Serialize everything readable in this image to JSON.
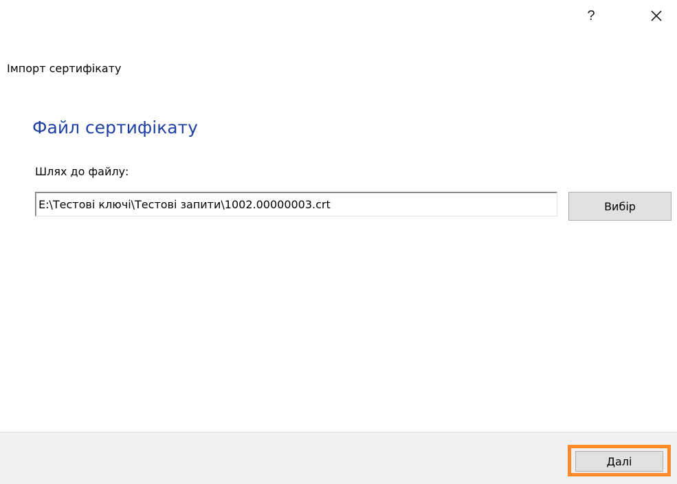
{
  "window": {
    "help_label": "?",
    "close_icon": "close-icon"
  },
  "wizard": {
    "title": "Імпорт сертифікату"
  },
  "main": {
    "heading": "Файл сертифікату",
    "path_label": "Шлях до файлу:",
    "path_value": "E:\\Тестові ключі\\Тестові запити\\1002.00000003.crt",
    "browse_label": "Вибір"
  },
  "footer": {
    "next_label": "Далі"
  },
  "colors": {
    "heading": "#1f3fa3",
    "highlight": "#ff8a2a",
    "footer_bg": "#f0f0f0",
    "button_bg": "#e1e1e1"
  }
}
